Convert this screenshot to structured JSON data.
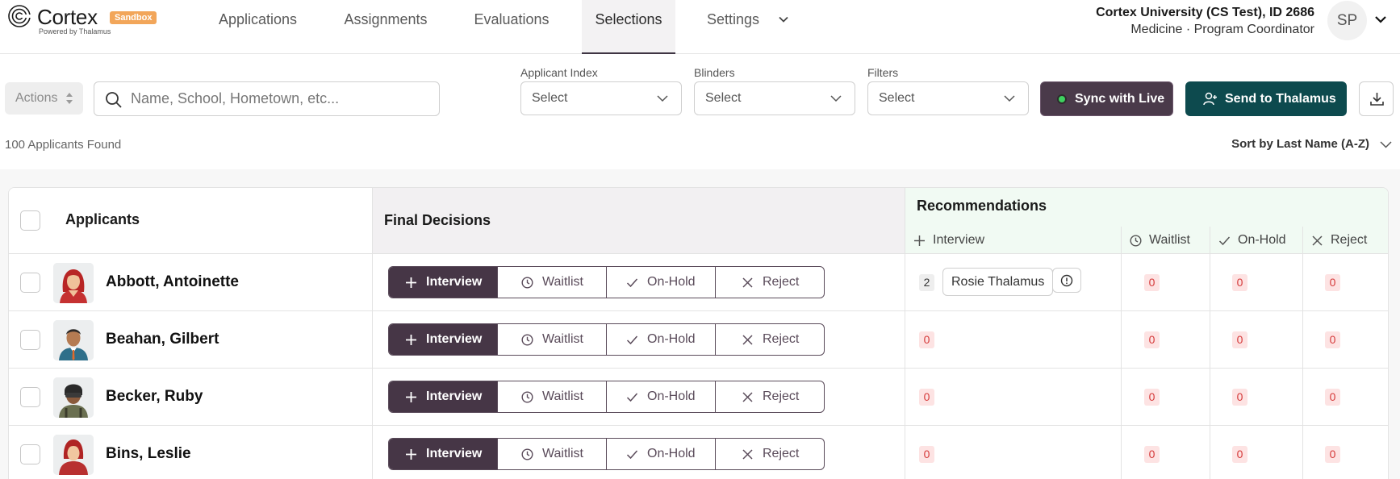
{
  "brand": {
    "name": "Cortex",
    "badge": "Sandbox",
    "tagline": "Powered by Thalamus"
  },
  "nav": {
    "items": [
      {
        "label": "Applications"
      },
      {
        "label": "Assignments"
      },
      {
        "label": "Evaluations"
      },
      {
        "label": "Selections",
        "active": true
      },
      {
        "label": "Settings"
      }
    ]
  },
  "account": {
    "name": "Cortex University (CS Test), ID 2686",
    "role": "Medicine · Program Coordinator",
    "initials": "SP"
  },
  "toolbar": {
    "actions_label": "Actions",
    "search_placeholder": "Name, School, Hometown, etc...",
    "filters": [
      {
        "label": "Applicant Index",
        "value": "Select"
      },
      {
        "label": "Blinders",
        "value": "Select"
      },
      {
        "label": "Filters",
        "value": "Select"
      }
    ],
    "sync_label": "Sync with Live",
    "send_label": "Send to Thalamus"
  },
  "results": {
    "count_text": "100 Applicants Found",
    "sort_text": "Sort by Last Name (A-Z)"
  },
  "table": {
    "headers": {
      "applicants": "Applicants",
      "final_decisions": "Final Decisions",
      "recommendations": "Recommendations"
    },
    "recommendation_columns": [
      "Interview",
      "Waitlist",
      "On-Hold",
      "Reject"
    ],
    "decision_options": [
      "Interview",
      "Waitlist",
      "On-Hold",
      "Reject"
    ],
    "rows": [
      {
        "name": "Abbott, Antoinette",
        "decision": "Interview",
        "interview_count": "2",
        "reviewer": "Rosie Thalamus",
        "waitlist": "0",
        "onhold": "0",
        "reject": "0"
      },
      {
        "name": "Beahan, Gilbert",
        "decision": "Interview",
        "interview_count": "0",
        "waitlist": "0",
        "onhold": "0",
        "reject": "0"
      },
      {
        "name": "Becker, Ruby",
        "decision": "Interview",
        "interview_count": "0",
        "waitlist": "0",
        "onhold": "0",
        "reject": "0"
      },
      {
        "name": "Bins, Leslie",
        "decision": "Interview",
        "interview_count": "0",
        "waitlist": "0",
        "onhold": "0",
        "reject": "0"
      }
    ]
  },
  "colors": {
    "primary_dark": "#463646",
    "teal": "#0d4a4e",
    "sandbox_badge": "#f2a65a",
    "live_dot": "#3ed15f",
    "zero_badge_text": "#d53a3a",
    "recommendations_bg": "#f1faf3",
    "final_decisions_bg": "#f2f0f2"
  },
  "icons": {
    "logo": "spiral-logo-icon",
    "nav_settings": "chevron-down-icon",
    "search": "search-icon",
    "send": "user-plus-icon",
    "download": "download-icon",
    "interview": "plus-icon",
    "waitlist": "clock-icon",
    "onhold": "check-icon",
    "reject": "x-icon",
    "info": "info-icon"
  }
}
